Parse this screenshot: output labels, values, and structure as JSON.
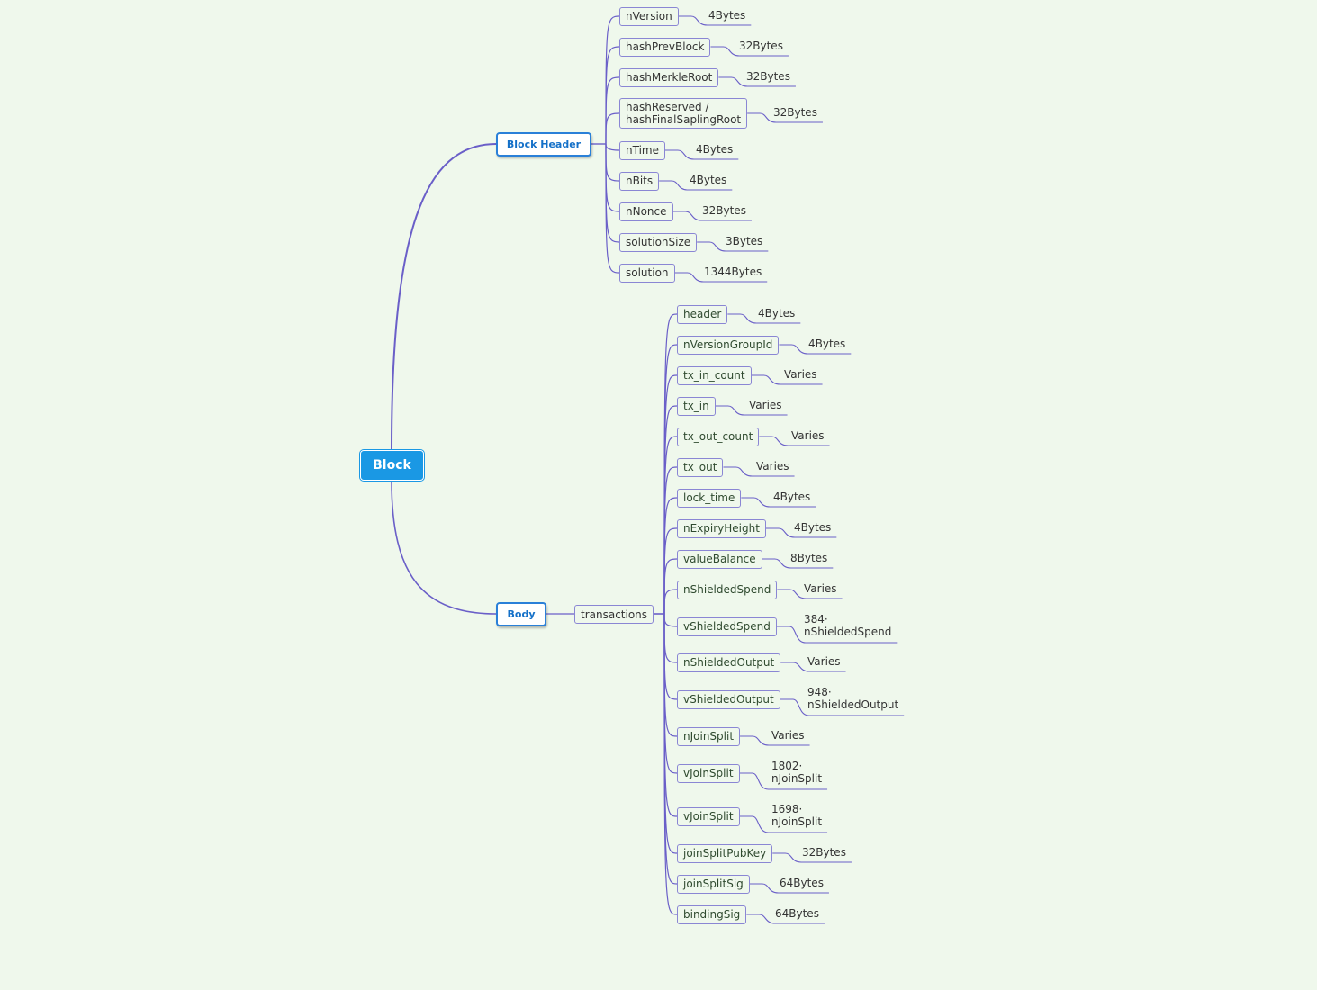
{
  "root": {
    "label": "Block"
  },
  "header": {
    "label": "Block Header",
    "fields": [
      {
        "name": "nVersion",
        "size": "4Bytes"
      },
      {
        "name": "hashPrevBlock",
        "size": "32Bytes"
      },
      {
        "name": "hashMerkleRoot",
        "size": "32Bytes"
      },
      {
        "name": "hashReserved /\nhashFinalSaplingRoot",
        "size": "32Bytes"
      },
      {
        "name": "nTime",
        "size": "4Bytes"
      },
      {
        "name": "nBits",
        "size": "4Bytes"
      },
      {
        "name": "nNonce",
        "size": "32Bytes"
      },
      {
        "name": "solutionSize",
        "size": "3Bytes"
      },
      {
        "name": "solution",
        "size": "1344Bytes"
      }
    ]
  },
  "body": {
    "label": "Body",
    "transactions": {
      "label": "transactions",
      "fields": [
        {
          "name": "header",
          "size": "4Bytes"
        },
        {
          "name": "nVersionGroupId",
          "size": "4Bytes"
        },
        {
          "name": "tx_in_count",
          "size": "Varies"
        },
        {
          "name": "tx_in",
          "size": "Varies"
        },
        {
          "name": "tx_out_count",
          "size": "Varies"
        },
        {
          "name": "tx_out",
          "size": "Varies"
        },
        {
          "name": "lock_time",
          "size": "4Bytes"
        },
        {
          "name": "nExpiryHeight",
          "size": "4Bytes"
        },
        {
          "name": "valueBalance",
          "size": "8Bytes"
        },
        {
          "name": "nShieldedSpend",
          "size": "Varies"
        },
        {
          "name": "vShieldedSpend",
          "size": "384·\nnShieldedSpend"
        },
        {
          "name": "nShieldedOutput",
          "size": "Varies"
        },
        {
          "name": "vShieldedOutput",
          "size": "948·\nnShieldedOutput"
        },
        {
          "name": "nJoinSplit",
          "size": "Varies"
        },
        {
          "name": "vJoinSplit",
          "size": "1802·\nnJoinSplit"
        },
        {
          "name": "vJoinSplit",
          "size": "1698·\nnJoinSplit"
        },
        {
          "name": "joinSplitPubKey",
          "size": "32Bytes"
        },
        {
          "name": "joinSplitSig",
          "size": "64Bytes"
        },
        {
          "name": "bindingSig",
          "size": "64Bytes"
        }
      ]
    }
  },
  "colors": {
    "background": "#eff8ec",
    "root_fill": "#1a98e4",
    "main_border": "#2a80d8",
    "main_text": "#1470c8",
    "link": "#6a5fc8",
    "sub_border": "#8a86d4"
  }
}
